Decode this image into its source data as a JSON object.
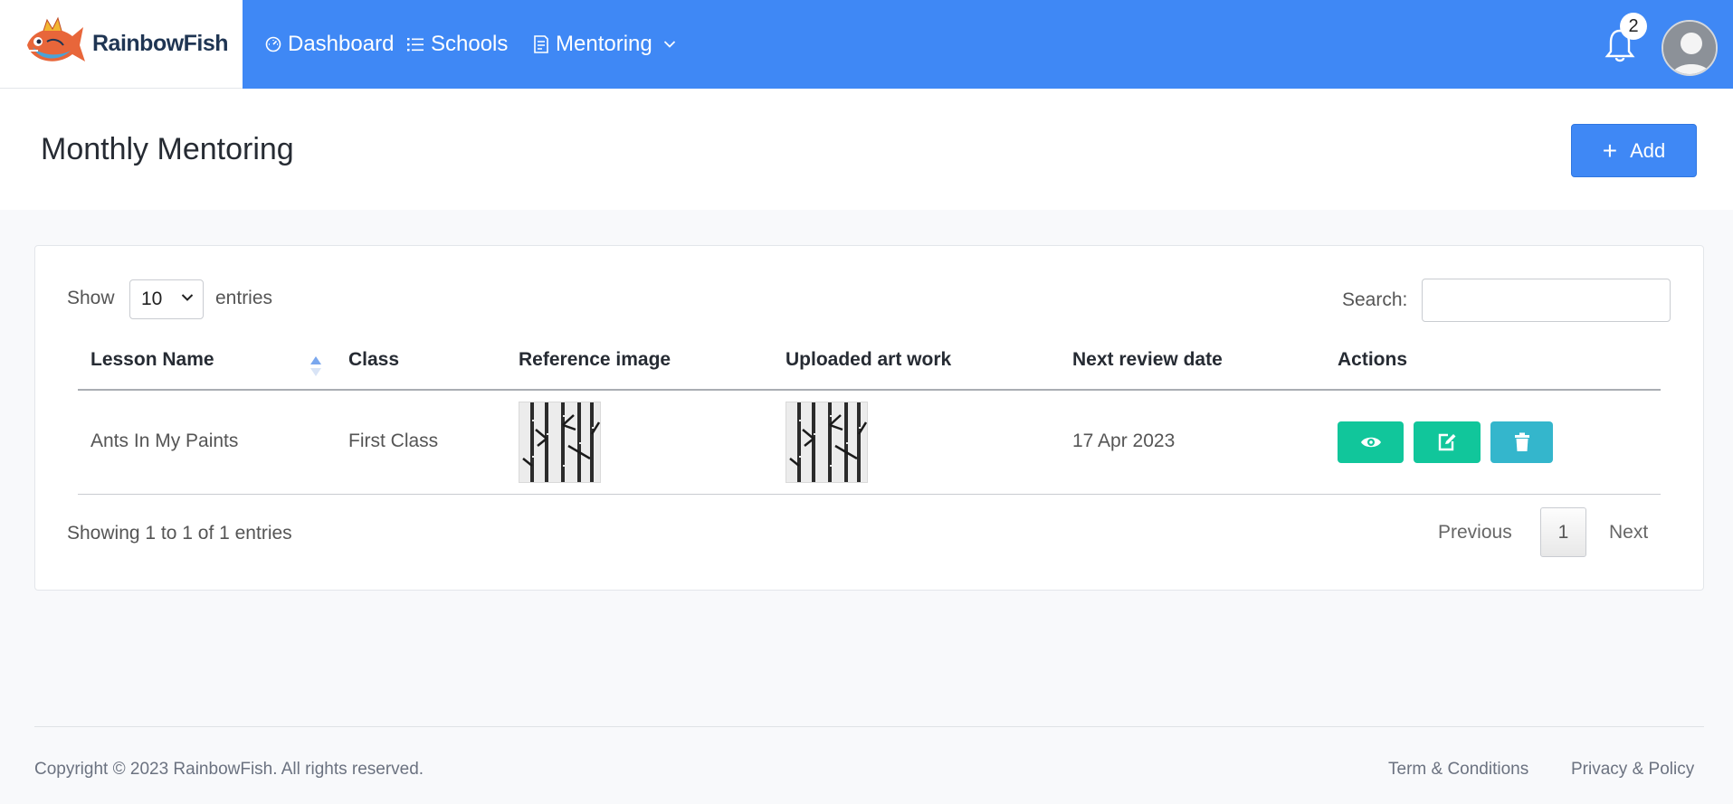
{
  "brand": {
    "name": "RainbowFish"
  },
  "nav": {
    "items": [
      {
        "label": "Dashboard",
        "icon": "gauge-icon"
      },
      {
        "label": "Schools",
        "icon": "list-icon"
      },
      {
        "label": "Mentoring",
        "icon": "document-icon",
        "dropdown": true
      }
    ]
  },
  "header": {
    "notification_count": "2"
  },
  "page": {
    "title": "Monthly Mentoring",
    "add_label": "Add"
  },
  "table_controls": {
    "show_label": "Show",
    "page_size": "10",
    "entries_label": "entries",
    "search_label": "Search:",
    "search_value": ""
  },
  "table": {
    "columns": [
      "Lesson Name",
      "Class",
      "Reference image",
      "Uploaded art work",
      "Next review date",
      "Actions"
    ],
    "sorted_column": "Lesson Name",
    "rows": [
      {
        "lesson_name": "Ants In My Paints",
        "class": "First Class",
        "reference_image": "bamboo-painting-thumbnail",
        "uploaded_art_work": "bamboo-painting-thumbnail",
        "next_review_date": "17 Apr 2023",
        "actions": [
          "view-icon",
          "edit-icon",
          "trash-icon"
        ]
      }
    ]
  },
  "pagination": {
    "info": "Showing 1 to 1 of 1 entries",
    "previous": "Previous",
    "current_page": "1",
    "next": "Next"
  },
  "footer": {
    "copyright": "Copyright © 2023 RainbowFish. All rights reserved.",
    "terms": "Term & Conditions",
    "privacy": "Privacy & Policy"
  },
  "colors": {
    "primary": "#3f88f5",
    "success": "#11c69b",
    "info": "#34b6cc"
  }
}
